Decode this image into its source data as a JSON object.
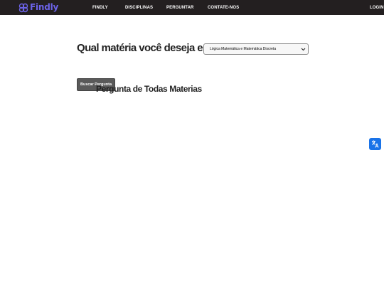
{
  "brand": {
    "name": "Findly",
    "color": "#6c63e8",
    "icon": "findly-logo-icon"
  },
  "nav": {
    "background": "#231f20",
    "items": [
      {
        "label": "FINDLY"
      },
      {
        "label": "DISCIPLINAS"
      },
      {
        "label": "PERGUNTAR"
      },
      {
        "label": "CONTATE-NOS"
      }
    ],
    "login_label": "LOGIN O"
  },
  "main": {
    "subject_prompt": "Qual matéria você deseja escolher?",
    "subject_select": {
      "selected": "Lógica Matemática e Matemática Discreta",
      "arrow_icon": "chevron-down-icon"
    },
    "search_button_label": "Buscar Pergunta",
    "results_title": "Pergunta de Todas Materias"
  },
  "widgets": {
    "translate_icon": "translate-icon",
    "translate_color": "#1a73e8"
  }
}
